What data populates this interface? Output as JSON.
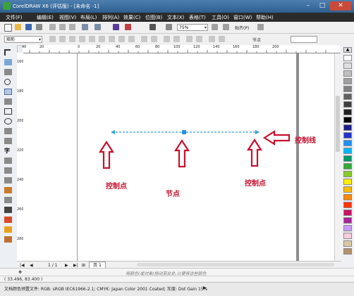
{
  "window": {
    "title": "CorelDRAW X6 (评估版) - [未命名 -1]",
    "controls": {
      "minimize": "–",
      "maximize": "□",
      "close": "✕"
    }
  },
  "menu": {
    "items": [
      "文件(F)",
      "编辑(E)",
      "视图(V)",
      "布局(L)",
      "排列(A)",
      "效果(C)",
      "位图(B)",
      "文本(X)",
      "表格(T)",
      "工具(O)",
      "窗口(W)",
      "帮助(H)"
    ]
  },
  "toolbar": {
    "zoom": "75%",
    "snap": "贴齐(P)"
  },
  "propertybar": {
    "shape_select": "矩形",
    "node_label": "节点"
  },
  "ruler": {
    "h_ticks": [
      "40",
      "20",
      "0",
      "20",
      "40",
      "60",
      "80",
      "100",
      "120",
      "140",
      "160",
      "180",
      "200"
    ],
    "v_ticks": [
      "160",
      "180",
      "200",
      "220",
      "240",
      "260",
      "280"
    ]
  },
  "annotations": {
    "left_control": "控制点",
    "node": "节点",
    "right_control": "控制点",
    "control_line": "控制线"
  },
  "bottom": {
    "page_counter": "1 / 1",
    "page_tab": "页 1",
    "hint": "将颜色(或对象)拖动至此处,以便将这些颜色"
  },
  "status": {
    "coords": "( 33.496, 83.400 )",
    "color_profile": "文档颜色预置文件: RGB: sRGB IEC61966-2.1; CMYK: Japan Color 2001 Coated; 灰度: Dot Gain 15%"
  },
  "palette": [
    "#ffffff",
    "#e0e0e0",
    "#c0c0c0",
    "#a0a0a0",
    "#808080",
    "#606060",
    "#404040",
    "#202020",
    "#000000",
    "#1c1c8c",
    "#2233cc",
    "#1e90ff",
    "#00b7ff",
    "#009966",
    "#33aa33",
    "#88cc22",
    "#ffee00",
    "#ffbb00",
    "#ff8800",
    "#ff3300",
    "#cc1166",
    "#aa2299",
    "#cc99ff",
    "#ffccdd",
    "#d9c9a3",
    "#b3926b"
  ]
}
